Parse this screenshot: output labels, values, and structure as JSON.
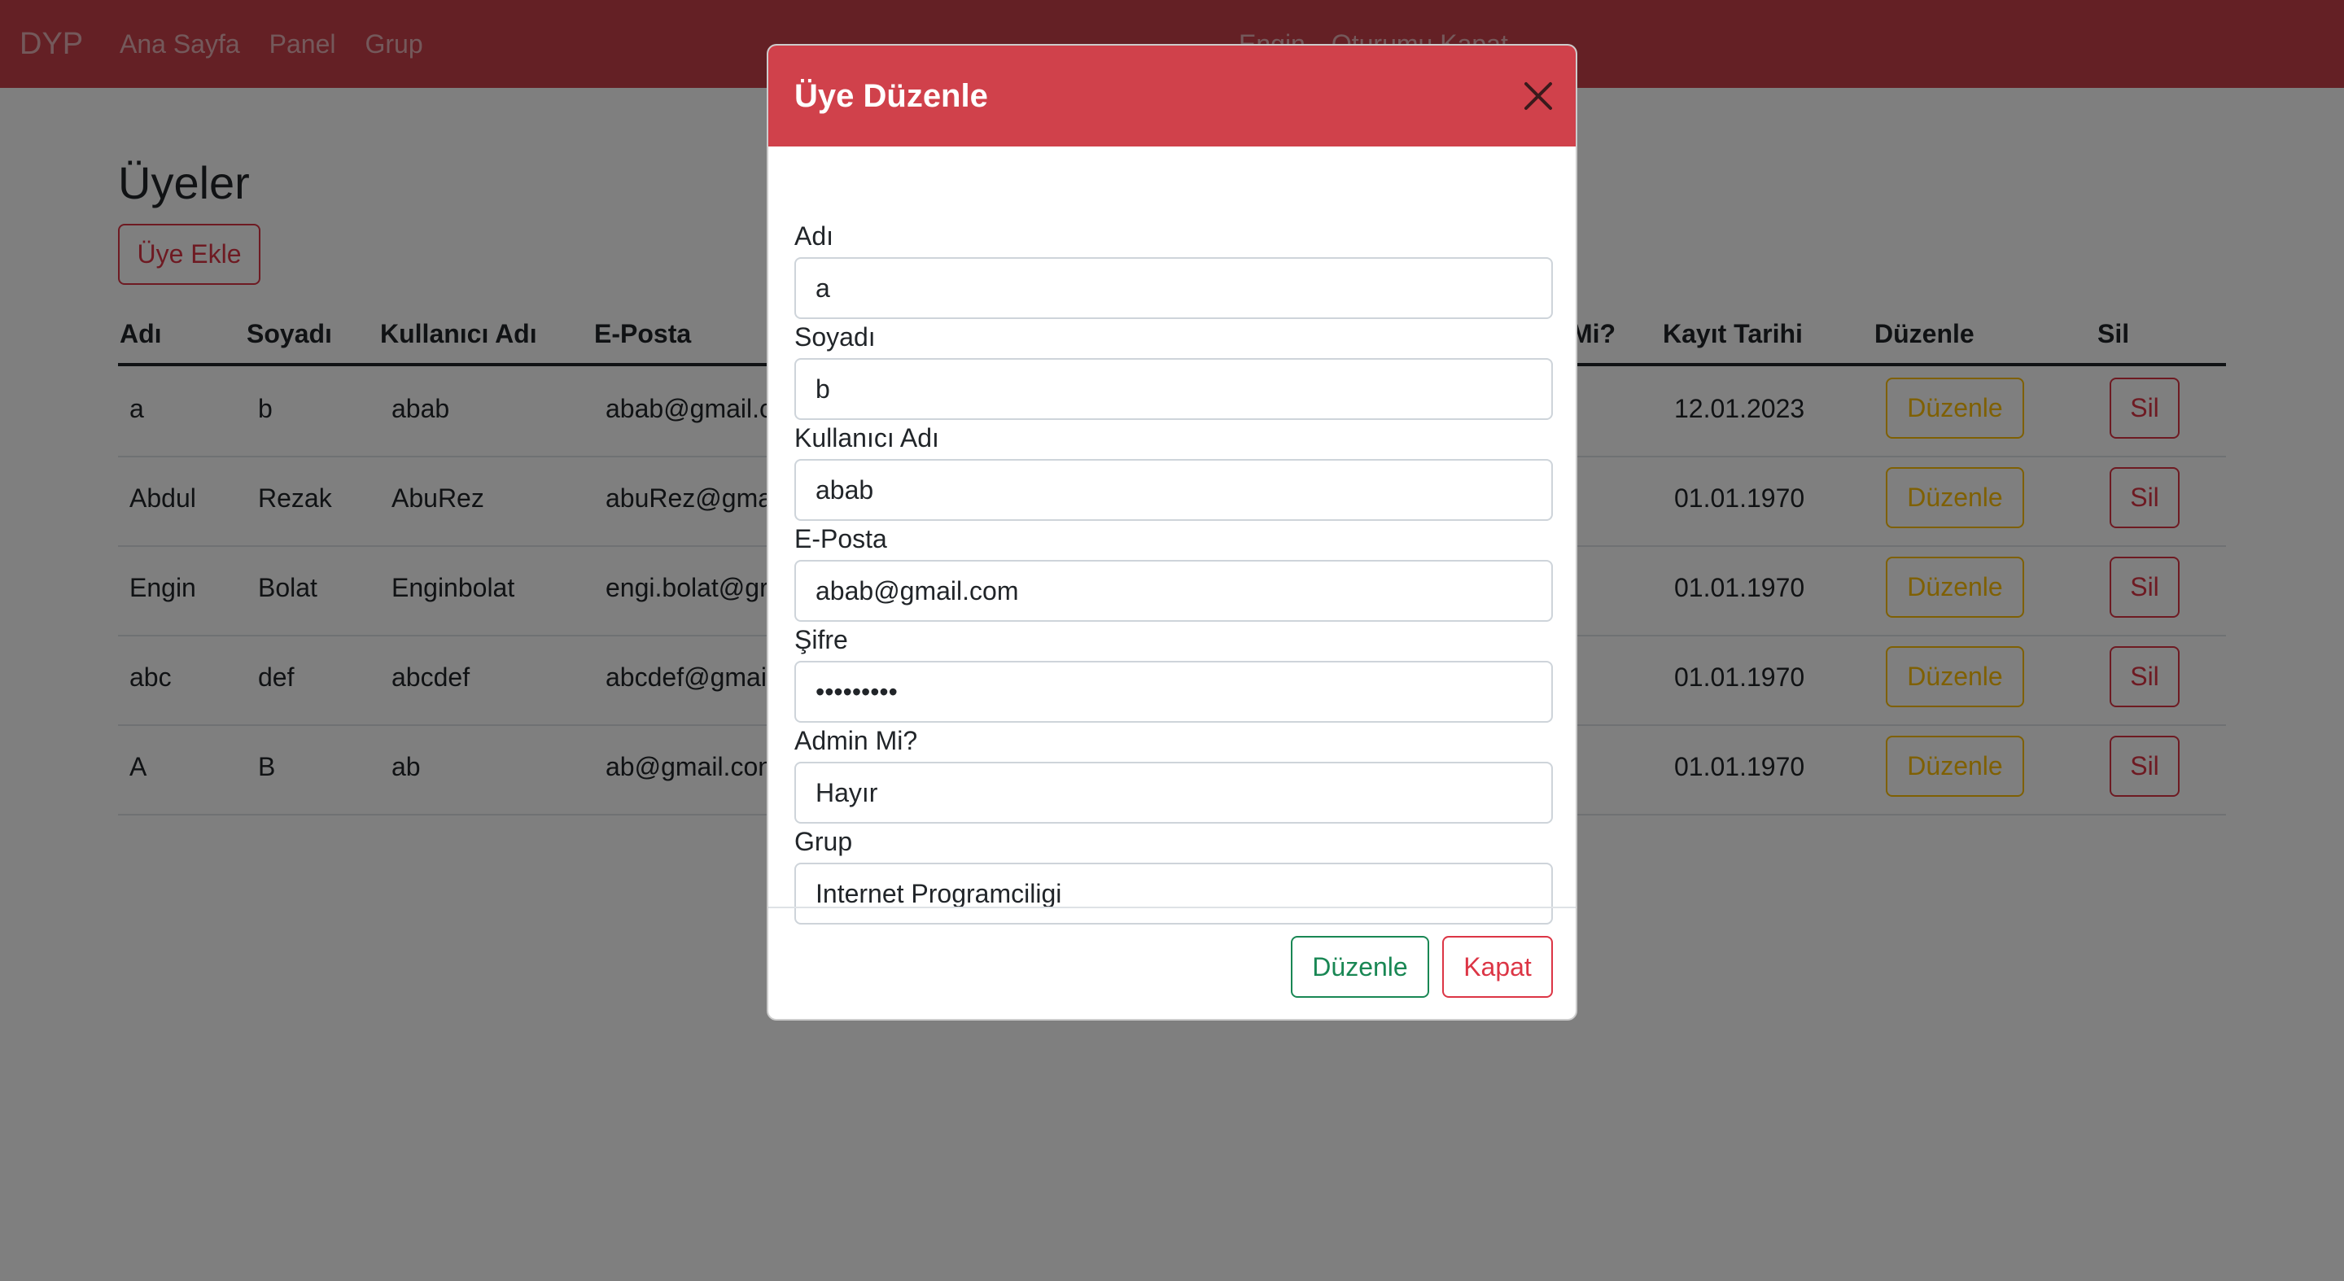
{
  "navbar": {
    "brand": "DYP",
    "links": [
      "Ana Sayfa",
      "Panel",
      "Grup"
    ],
    "user": "Engin",
    "logout": "Oturumu Kapat"
  },
  "page": {
    "title": "Üyeler",
    "add_button": "Üye Ekle"
  },
  "table": {
    "headers": {
      "first_name": "Adı",
      "last_name": "Soyadı",
      "username": "Kullanıcı Adı",
      "email": "E-Posta",
      "admin": "Mi?",
      "registered": "Kayıt Tarihi",
      "edit": "Düzenle",
      "delete": "Sil"
    },
    "edit_label": "Düzenle",
    "delete_label": "Sil",
    "rows": [
      {
        "first_name": "a",
        "last_name": "b",
        "username": "abab",
        "email": "abab@gmail.c",
        "registered": "12.01.2023"
      },
      {
        "first_name": "Abdul",
        "last_name": "Rezak",
        "username": "AbuRez",
        "email": "abuRez@gma",
        "registered": "01.01.1970"
      },
      {
        "first_name": "Engin",
        "last_name": "Bolat",
        "username": "Enginbolat",
        "email": "engi.bolat@gr",
        "registered": "01.01.1970"
      },
      {
        "first_name": "abc",
        "last_name": "def",
        "username": "abcdef",
        "email": "abcdef@gmai",
        "registered": "01.01.1970"
      },
      {
        "first_name": "A",
        "last_name": "B",
        "username": "ab",
        "email": "ab@gmail.con",
        "registered": "01.01.1970"
      }
    ]
  },
  "modal": {
    "title": "Üye Düzenle",
    "fields": [
      {
        "label": "Adı",
        "value": "a"
      },
      {
        "label": "Soyadı",
        "value": "b"
      },
      {
        "label": "Kullanıcı Adı",
        "value": "abab"
      },
      {
        "label": "E-Posta",
        "value": "abab@gmail.com"
      },
      {
        "label": "Şifre",
        "value": "•••••••••"
      },
      {
        "label": "Admin Mi?",
        "value": "Hayır"
      },
      {
        "label": "Grup",
        "value": "Internet Programciligi"
      }
    ],
    "save_button": "Düzenle",
    "close_button": "Kapat"
  },
  "colors": {
    "navbar": "#c9404a",
    "modal_header": "#d0414b",
    "danger": "#dc3545",
    "warning": "#ffc107",
    "success": "#198754"
  }
}
